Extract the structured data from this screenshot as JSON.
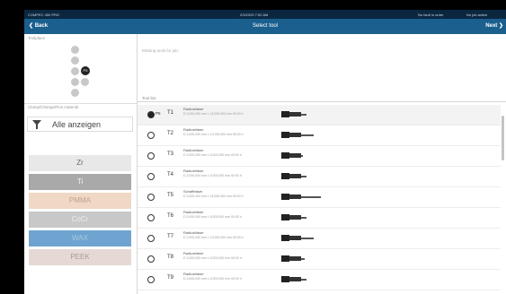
{
  "status_bar": {
    "app_name": "COMPEC 450 PRO",
    "datetime": "2/9/2025 7:52 AM",
    "tool_status": "No fault in order",
    "job_status": "No job active"
  },
  "nav": {
    "back_label": "Back",
    "title": "Select tool",
    "next_label": "Next"
  },
  "toolplace": {
    "label": "Toolplace",
    "selected_position": "P5"
  },
  "material": {
    "label": "Clamp/Change/Pos material",
    "filter_label": "Alle anzeigen",
    "items": [
      {
        "name": "Zr",
        "color": "#e8e8e8",
        "text_color": "#666666"
      },
      {
        "name": "Ti",
        "color": "#a9a9a9",
        "text_color": "#f2f2f2"
      },
      {
        "name": "PMMA",
        "color": "#efd8c5",
        "text_color": "#bfa38c"
      },
      {
        "name": "CoCr",
        "color": "#c8c8c8",
        "text_color": "#eeeeee"
      },
      {
        "name": "WAX",
        "color": "#6ea4cf",
        "text_color": "#a8c8e4"
      },
      {
        "name": "PEEK",
        "color": "#e6d9d5",
        "text_color": "#a89c99"
      }
    ]
  },
  "missing_tools_label": "Missing tools for job:",
  "tool_list": {
    "label": "Tool list",
    "rows": [
      {
        "pos": "P5",
        "id": "T1",
        "name": "Radiusfräser",
        "desc": "D 3,000,000 mm L 15,000,000 mm 00:00 h",
        "selected": true,
        "tip": 6
      },
      {
        "pos": "",
        "id": "T2",
        "name": "Radiusfräser",
        "desc": "D 3,000,000 mm L 10,000,000 mm 00:00 h",
        "selected": false,
        "tip": 14
      },
      {
        "pos": "",
        "id": "T3",
        "name": "Radiusfräser",
        "desc": "D 3,000,000 mm L 5,000,000 mm 00:00 h",
        "selected": false,
        "tip": 2
      },
      {
        "pos": "",
        "id": "T4",
        "name": "Radiusfräser",
        "desc": "D 3,000,000 mm L 5,000,000 mm 00:00 h",
        "selected": false,
        "tip": 6
      },
      {
        "pos": "",
        "id": "T5",
        "name": "Schaftfräser",
        "desc": "D 3,000,000 mm L 15,000,000 mm 00:00 h",
        "selected": false,
        "tip": 22
      },
      {
        "pos": "",
        "id": "T6",
        "name": "Radiusfräser",
        "desc": "D 3,000,000 mm L 5,000,000 mm 00:00 h",
        "selected": false,
        "tip": 6
      },
      {
        "pos": "",
        "id": "T7",
        "name": "Radiusfräser",
        "desc": "D 3,000,000 mm L 10,000,000 mm 00:00 h",
        "selected": false,
        "tip": 14
      },
      {
        "pos": "",
        "id": "T8",
        "name": "Radiusfräser",
        "desc": "D 3,000,000 mm L 5,000,000 mm 00:00 h",
        "selected": false,
        "tip": 4
      },
      {
        "pos": "",
        "id": "T9",
        "name": "Radiusfräser",
        "desc": "D 3,000,000 mm L 5,000,000 mm 00:00 h",
        "selected": false,
        "tip": 6
      }
    ]
  }
}
